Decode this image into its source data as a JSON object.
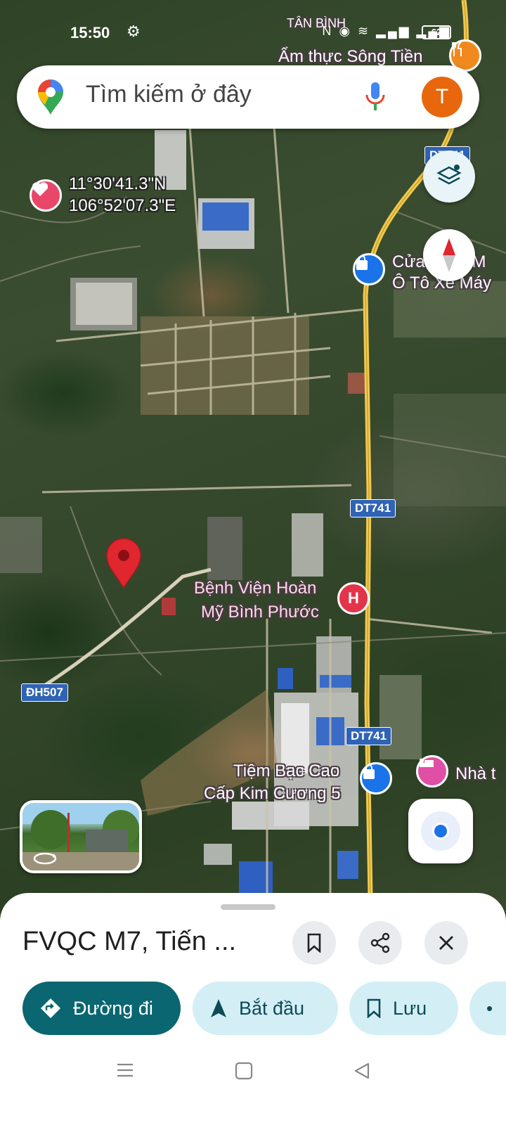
{
  "status_bar": {
    "time": "15:50",
    "battery": "62",
    "network_icons": "N ◉ ≋ ▂▄▆ ▂▄▆"
  },
  "search": {
    "placeholder": "Tìm kiếm ở đây",
    "avatar_letter": "T"
  },
  "map": {
    "coordinates": {
      "lat": "11°30'41.3\"N",
      "lng": "106°52'07.3\"E"
    },
    "area_label": "TÂN BÌNH",
    "road_labels": [
      "DT741",
      "DT741",
      "DT741",
      "ĐH507"
    ],
    "pois": {
      "restaurant": "Ẩm thực Sông Tiền",
      "shop1_line1": "Cửa hàng M",
      "shop1_line2": "Ô Tô Xe Máy",
      "hospital_line1": "Bệnh Viện Hoàn",
      "hospital_line2": "Mỹ Bình Phước",
      "hospital_glyph": "H",
      "jewelry_line1": "Tiệm Bạc Cao",
      "jewelry_line2": "Cấp Kim Cương 5",
      "hotel": "Nhà t"
    },
    "colors": {
      "pin_red": "#e0262e",
      "poi_blue": "#1a73e8",
      "hospital_red": "#e3344a",
      "hotel_pink": "#e04ea6",
      "road_yellow": "#f2c94c"
    }
  },
  "place": {
    "title": "FVQC M7, Tiến ..."
  },
  "actions": {
    "directions": "Đường đi",
    "start": "Bắt đầu",
    "save": "Lưu"
  }
}
